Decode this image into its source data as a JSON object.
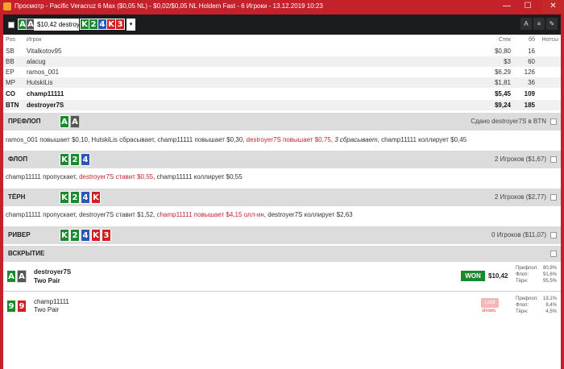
{
  "window": {
    "title": "Просмотр - Pacific Veracruz 6 Max ($0,05 NL) - $0,02/$0,05 NL Holdem Fast - 6 Игроки - 13.12.2019 10:23",
    "minimize": "—",
    "maximize": "☐",
    "close": "✕"
  },
  "toolbar": {
    "hero_cards": [
      {
        "rank": "A",
        "suit": "spades"
      },
      {
        "rank": "A",
        "suit": "spades"
      }
    ],
    "hero_select_text": "$10,42 destroyer7S",
    "board_cards": [
      {
        "rank": "K",
        "suit": "clubs"
      },
      {
        "rank": "2",
        "suit": "clubs"
      },
      {
        "rank": "4",
        "suit": "diamonds"
      },
      {
        "rank": "K",
        "suit": "hearts"
      },
      {
        "rank": "3",
        "suit": "hearts"
      }
    ],
    "dropdown_arrow": "▾",
    "btn_font": "A",
    "btn_list": "≡",
    "btn_edit": "✎"
  },
  "players": {
    "headers": {
      "pos": "Pos",
      "name": "Игрок",
      "stack": "Стек",
      "bb": "бб",
      "notes": "Нотсы"
    },
    "rows": [
      {
        "pos": "SB",
        "name": "Vitalkotov95",
        "stack": "$0,80",
        "bb": "16"
      },
      {
        "pos": "BB",
        "name": "alacug",
        "stack": "$3",
        "bb": "60"
      },
      {
        "pos": "EP",
        "name": "ramos_001",
        "stack": "$6,29",
        "bb": "126"
      },
      {
        "pos": "MP",
        "name": "HutskiLis",
        "stack": "$1,81",
        "bb": "36"
      },
      {
        "pos": "CO",
        "name": "champ11111",
        "stack": "$5,45",
        "bb": "109"
      },
      {
        "pos": "BTN",
        "name": "destroyer7S",
        "stack": "$9,24",
        "bb": "185"
      }
    ]
  },
  "preflop": {
    "label": "ПРЕФЛОП",
    "info": "Сдано destroyer7S в BTN",
    "cards": [
      {
        "rank": "A"
      },
      {
        "rank": "A"
      }
    ],
    "actions": [
      {
        "text": "ramos_001 повышает $0,10, HutskiLis сбрасывает, champ11111 повышает $0,30, ",
        "style": ""
      },
      {
        "text": "destroyer7S повышает $0,75",
        "style": "red"
      },
      {
        "text": ", ",
        "style": ""
      },
      {
        "text": "3 сбрасывает",
        "style": "it"
      },
      {
        "text": ", champ11111 коллирует $0,45",
        "style": ""
      }
    ]
  },
  "flop": {
    "label": "ФЛОП",
    "info": "2 Игроков ($1,67)",
    "cards": [
      {
        "rank": "K"
      },
      {
        "rank": "2"
      },
      {
        "rank": "4"
      }
    ],
    "actions": [
      {
        "text": "champ11111 пропускает, ",
        "style": ""
      },
      {
        "text": "destroyer7S ставит $0,55",
        "style": "red"
      },
      {
        "text": ", champ11111 коллирует $0,55",
        "style": ""
      }
    ]
  },
  "turn": {
    "label": "ТЁРН",
    "info": "2 Игроков ($2,77)",
    "cards": [
      {
        "rank": "K"
      },
      {
        "rank": "2"
      },
      {
        "rank": "4"
      },
      {
        "rank": "K"
      }
    ],
    "actions": [
      {
        "text": "champ11111 пропускает, destroyer7S ставит $1,52, ",
        "style": ""
      },
      {
        "text": "champ11111 повышает $4,15 олл-ин",
        "style": "red"
      },
      {
        "text": ", destroyer7S коллирует $2,63",
        "style": ""
      }
    ]
  },
  "river": {
    "label": "РИВЕР",
    "info": "0 Игроков ($11,07)",
    "cards": [
      {
        "rank": "K"
      },
      {
        "rank": "2"
      },
      {
        "rank": "4"
      },
      {
        "rank": "K"
      },
      {
        "rank": "3"
      }
    ]
  },
  "showdown": {
    "label": "ВСКРЫТИЕ",
    "winner": {
      "cards": [
        {
          "rank": "A"
        },
        {
          "rank": "A"
        }
      ],
      "name": "destroyer7S",
      "hand": "Two Pair",
      "badge": "WON",
      "amount": "$10,42",
      "eq_labels": [
        "Префлоп:",
        "Флоп:",
        "Тёрн:"
      ],
      "eq_values": [
        "80,9%",
        "91,6%",
        "95,5%"
      ]
    },
    "loser": {
      "cards": [
        {
          "rank": "9"
        },
        {
          "rank": "9"
        }
      ],
      "name": "champ11111",
      "hand": "Two Pair",
      "badge": "Lost",
      "shows": "shows",
      "eq_labels": [
        "Префлоп:",
        "Флоп:",
        "Тёрн:"
      ],
      "eq_values": [
        "19,1%",
        "8,4%",
        "4,5%"
      ]
    }
  }
}
